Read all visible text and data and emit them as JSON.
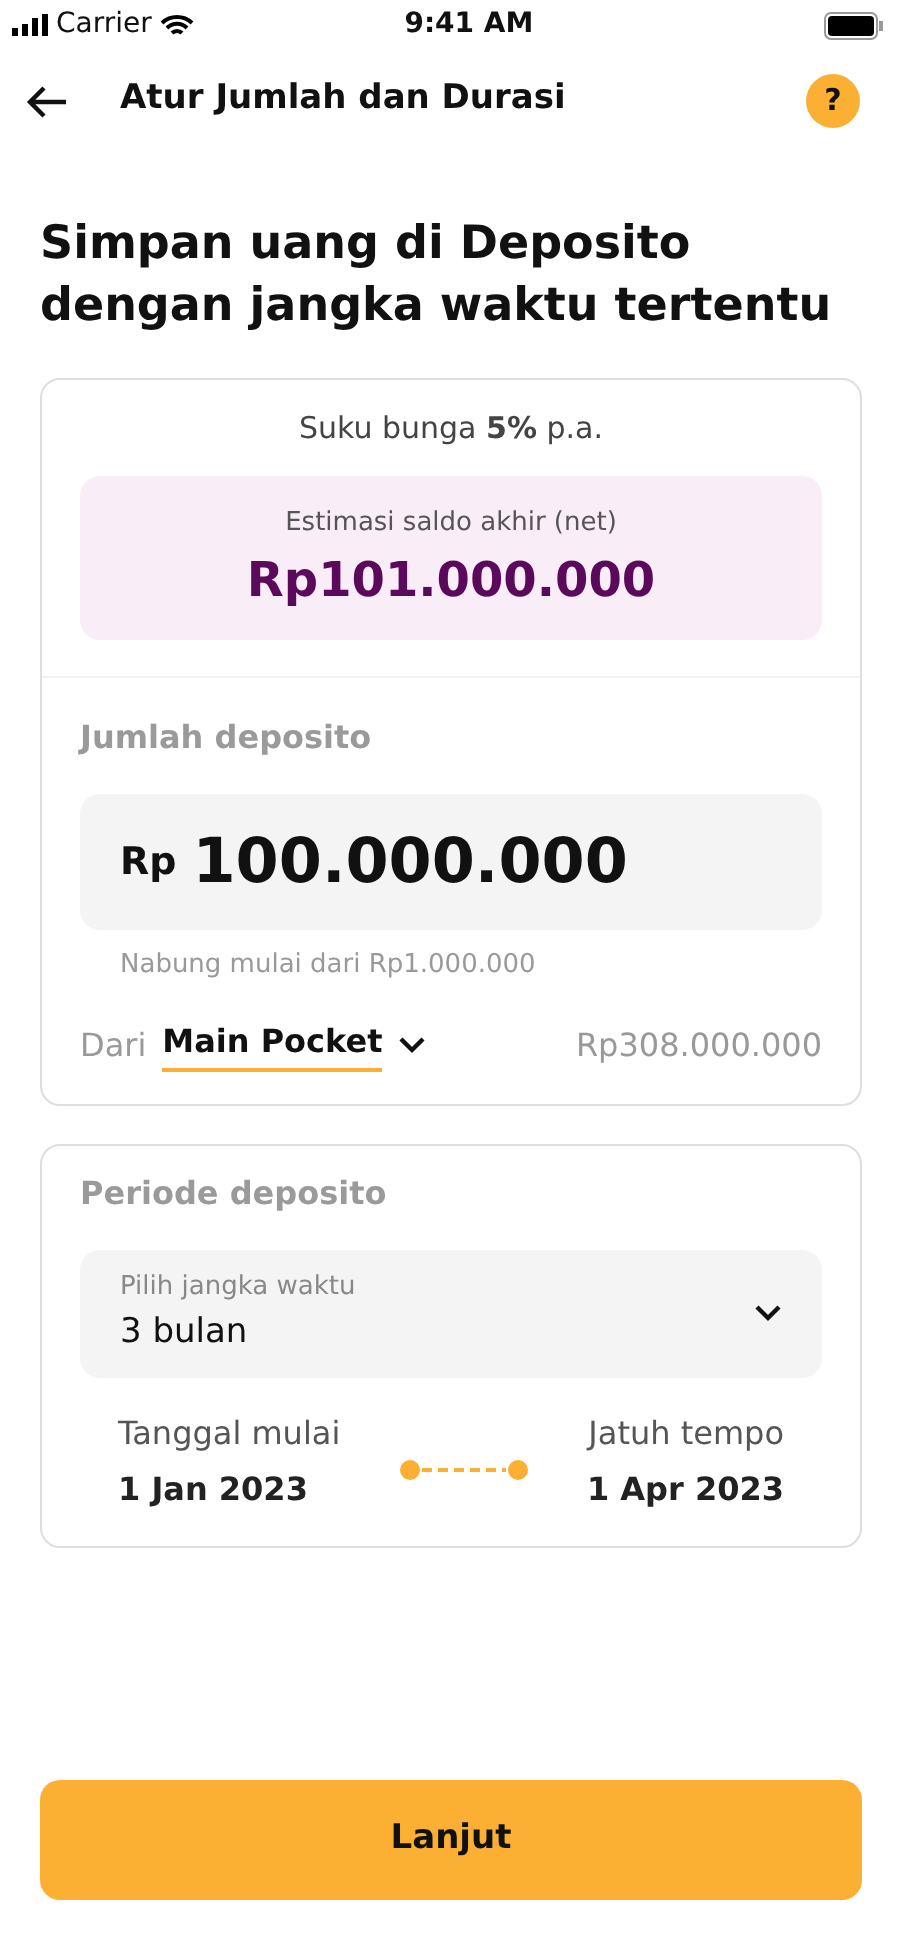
{
  "status_bar": {
    "carrier": "Carrier",
    "time": "9:41 AM"
  },
  "header": {
    "title": "Atur Jumlah dan Durasi",
    "help": "?"
  },
  "headline": "Simpan uang di Deposito dengan jangka waktu tertentu",
  "summary": {
    "interest": "Suku bunga **5%** p.a.",
    "estimate_label": "Estimasi saldo akhir (net)",
    "estimate_value": "Rp101.000.000"
  },
  "amount": {
    "label": "Jumlah deposito",
    "currency": "Rp",
    "value": "100.000.000",
    "hint": "Nabung mulai dari Rp1.000.000",
    "source_prefix": "Dari",
    "source": "Main Pocket",
    "balance": "Rp308.000.000"
  },
  "period": {
    "label": "Periode deposito",
    "select_label": "Pilih jangka waktu",
    "select_value": "3 bulan",
    "start_label": "Tanggal mulai",
    "start_date": "1 Jan 2023",
    "end_label": "Jatuh tempo",
    "end_date": "1 Apr 2023"
  },
  "button": "Lanjut"
}
